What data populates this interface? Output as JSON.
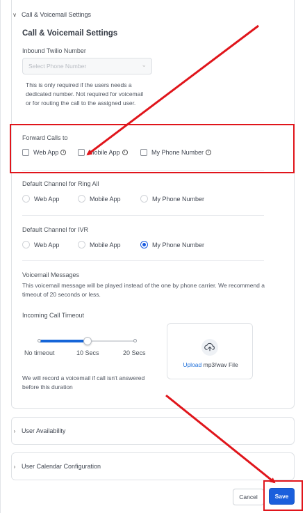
{
  "accordion": {
    "call_voicemail": {
      "header": "Call & Voicemail Settings",
      "title": "Call & Voicemail Settings"
    },
    "user_availability": {
      "header": "User Availability"
    },
    "user_calendar": {
      "header": "User Calendar Configuration"
    }
  },
  "inbound": {
    "label": "Inbound Twilio Number",
    "placeholder": "Select Phone Number",
    "helper": "This is only required if the users needs a dedicated number. Not required for voicemail or for routing the call to the assigned user."
  },
  "forward_calls": {
    "label": "Forward Calls to",
    "options": [
      {
        "label": "Web App",
        "checked": false,
        "info": true
      },
      {
        "label": "Mobile App",
        "checked": false,
        "info": true
      },
      {
        "label": "My Phone Number",
        "checked": false,
        "info": true
      }
    ]
  },
  "ring_all": {
    "label": "Default Channel for Ring All",
    "options": [
      {
        "label": "Web App",
        "selected": false
      },
      {
        "label": "Mobile App",
        "selected": false
      },
      {
        "label": "My Phone Number",
        "selected": false
      }
    ]
  },
  "ivr": {
    "label": "Default Channel for IVR",
    "options": [
      {
        "label": "Web App",
        "selected": false
      },
      {
        "label": "Mobile App",
        "selected": false
      },
      {
        "label": "My Phone Number",
        "selected": true
      }
    ]
  },
  "voicemail": {
    "label": "Voicemail Messages",
    "description": "This voicemail message will be played instead of the one by phone carrier. We recommend a timeout of 20 seconds or less."
  },
  "timeout": {
    "label": "Incoming Call Timeout",
    "stops": [
      "No timeout",
      "10 Secs",
      "20 Secs"
    ],
    "selected_index": 1,
    "note": "We will record a voicemail if call isn't answered before this duration"
  },
  "upload": {
    "link": "Upload",
    "text": " mp3/wav File"
  },
  "actions": {
    "cancel": "Cancel",
    "save": "Save"
  },
  "colors": {
    "primary": "#1a5fdc",
    "annotation": "#e0151b"
  }
}
